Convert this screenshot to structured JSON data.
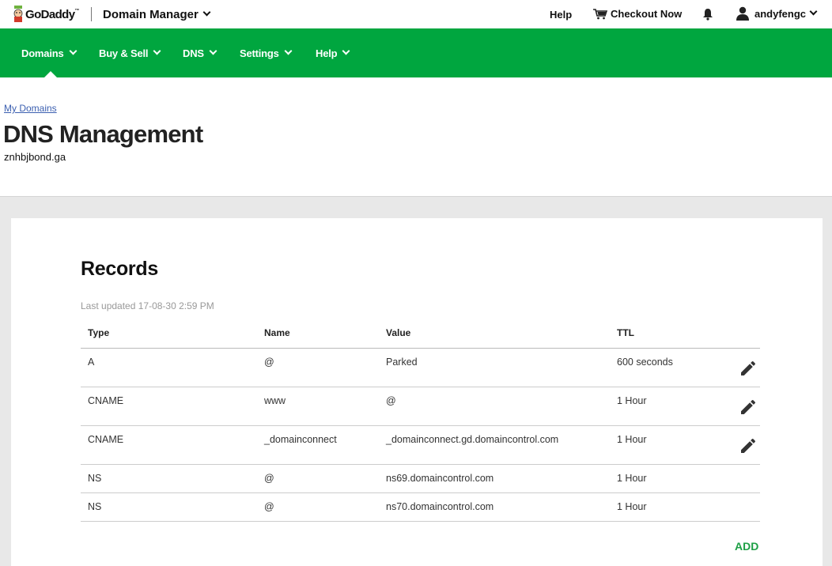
{
  "topbar": {
    "brand": "GoDaddy",
    "brand_tm": "™",
    "product_switcher": "Domain Manager",
    "help": "Help",
    "checkout": "Checkout Now",
    "username": "andyfengc"
  },
  "nav": {
    "items": [
      {
        "label": "Domains",
        "active": true
      },
      {
        "label": "Buy & Sell"
      },
      {
        "label": "DNS"
      },
      {
        "label": "Settings"
      },
      {
        "label": "Help"
      }
    ]
  },
  "header": {
    "breadcrumb": "My Domains",
    "title": "DNS Management",
    "domain": "znhbjbond.ga"
  },
  "records": {
    "title": "Records",
    "last_updated": "Last updated 17-08-30 2:59 PM",
    "columns": [
      "Type",
      "Name",
      "Value",
      "TTL"
    ],
    "rows": [
      {
        "type": "A",
        "name": "@",
        "value": "Parked",
        "ttl": "600 seconds",
        "editable": true
      },
      {
        "type": "CNAME",
        "name": "www",
        "value": "@",
        "ttl": "1 Hour",
        "editable": true
      },
      {
        "type": "CNAME",
        "name": "_domainconnect",
        "value": "_domainconnect.gd.domaincontrol.com",
        "ttl": "1 Hour",
        "editable": true
      },
      {
        "type": "NS",
        "name": "@",
        "value": "ns69.domaincontrol.com",
        "ttl": "1 Hour",
        "editable": false
      },
      {
        "type": "NS",
        "name": "@",
        "value": "ns70.domaincontrol.com",
        "ttl": "1 Hour",
        "editable": false
      }
    ],
    "add_label": "ADD"
  },
  "colors": {
    "brand_green": "#00a63f",
    "add_green": "#1ea046",
    "link_blue": "#3b5fb0"
  },
  "icons": [
    "godaddy-logo-icon",
    "chevron-down-icon",
    "cart-icon",
    "bell-icon",
    "user-icon",
    "pencil-icon"
  ]
}
